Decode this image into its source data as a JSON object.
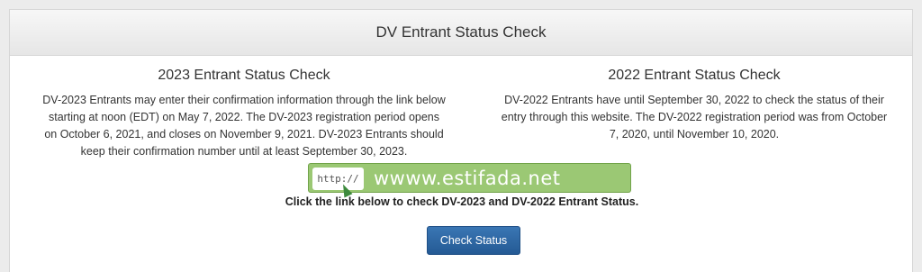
{
  "panel": {
    "title": "DV Entrant Status Check"
  },
  "left": {
    "heading": "2023 Entrant Status Check",
    "body": "DV-2023 Entrants may enter their confirmation information through the link below starting at noon (EDT) on May 7, 2022. The DV-2023 registration period opens on October 6, 2021, and closes on November 9, 2021. DV-2023 Entrants should keep their confirmation number until at least September 30, 2023."
  },
  "right": {
    "heading": "2022 Entrant Status Check",
    "body": "DV-2022 Entrants have until September 30, 2022 to check the status of their entry through this website. The DV-2022 registration period was from October 7, 2020, until November 10, 2020."
  },
  "instruction": "Click the link below to check DV-2023 and DV-2022 Entrant Status.",
  "button": {
    "label": "Check Status"
  },
  "watermark": {
    "prefix": "http://",
    "text": "wwww.estifada.net"
  },
  "colors": {
    "button": "#2b64a3",
    "header_bg": "#eeeeee",
    "watermark": "#8abe5c"
  }
}
